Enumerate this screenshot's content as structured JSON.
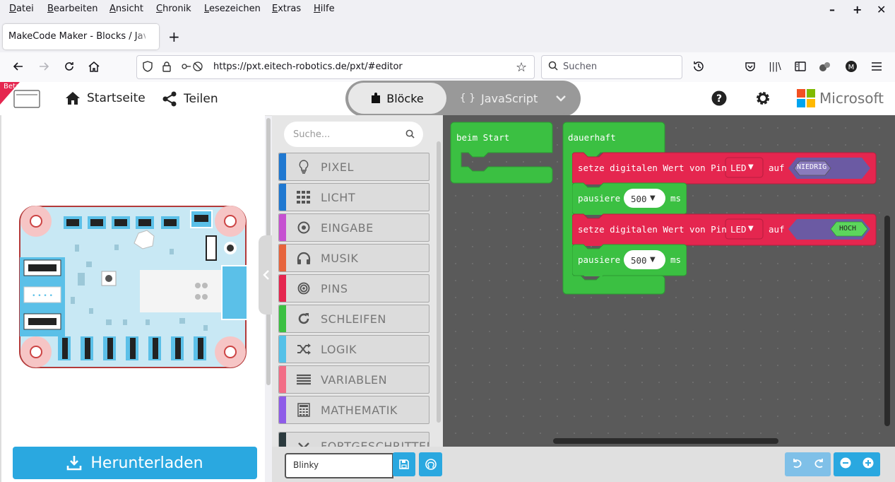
{
  "menubar": {
    "items": [
      {
        "u": "D",
        "rest": "atei"
      },
      {
        "u": "B",
        "rest": "earbeiten"
      },
      {
        "u": "A",
        "rest": "nsicht"
      },
      {
        "u": "C",
        "rest": "hronik"
      },
      {
        "u": "L",
        "rest": "esezeichen"
      },
      {
        "u": "E",
        "rest": "xtras"
      },
      {
        "u": "H",
        "rest": "ilfe"
      }
    ]
  },
  "tab": {
    "title": "MakeCode Maker - Blocks / JavaScript"
  },
  "nav": {
    "url": "https://pxt.eitech-robotics.de/pxt/#editor",
    "search_placeholder": "Suchen"
  },
  "header": {
    "beta": "Beta",
    "home": "Startseite",
    "share": "Teilen",
    "blocks": "Blöcke",
    "javascript": "JavaScript",
    "js_braces": "{ }",
    "brand": "Microsoft"
  },
  "toolbox": {
    "search_placeholder": "Suche...",
    "categories": [
      {
        "label": "PIXEL",
        "color": "#1f78d1",
        "icon": "lightbulb-icon"
      },
      {
        "label": "LICHT",
        "color": "#1f78d1",
        "icon": "grid-icon"
      },
      {
        "label": "EINGABE",
        "color": "#c651d1",
        "icon": "target-icon"
      },
      {
        "label": "MUSIK",
        "color": "#e7643c",
        "icon": "headphones-icon"
      },
      {
        "label": "PINS",
        "color": "#e5264f",
        "icon": "pins-icon"
      },
      {
        "label": "SCHLEIFEN",
        "color": "#3bc042",
        "icon": "loop-icon"
      },
      {
        "label": "LOGIK",
        "color": "#54c1e8",
        "icon": "shuffle-icon"
      },
      {
        "label": "VARIABLEN",
        "color": "#f26d86",
        "icon": "list-icon"
      },
      {
        "label": "MATHEMATIK",
        "color": "#8e5ce8",
        "icon": "calculator-icon"
      },
      {
        "label": "FORTGESCHRITTEN",
        "color": "#2b3a3e",
        "icon": "chevron-icon"
      }
    ]
  },
  "blocks": {
    "on_start": "beim Start",
    "forever": "dauerhaft",
    "set1": {
      "text": "setze digitalen Wert von Pin",
      "pin": "LED",
      "on": "auf",
      "value": "NIEDRIG"
    },
    "pause1": {
      "text": "pausiere",
      "value": "500",
      "unit": "ms"
    },
    "set2": {
      "text": "setze digitalen Wert von Pin",
      "pin": "LED",
      "on": "auf",
      "value": "HOCH"
    },
    "pause2": {
      "text": "pausiere",
      "value": "500",
      "unit": "ms"
    }
  },
  "footer": {
    "download": "Herunterladen",
    "project_name": "Blinky"
  },
  "colors": {
    "event_green": "#3bc042",
    "pins_red": "#e5264f",
    "download_blue": "#2aa8e0"
  }
}
